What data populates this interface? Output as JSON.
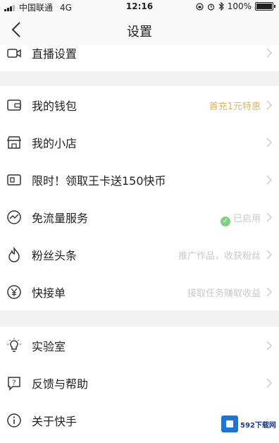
{
  "status_bar": {
    "carrier": "中国联通",
    "network": "4G",
    "time": "12:16",
    "battery": "100%"
  },
  "nav": {
    "title": "设置"
  },
  "groups": [
    {
      "items": [
        {
          "label": "直播设置",
          "value": "",
          "icon": "video-camera-icon"
        }
      ]
    },
    {
      "items": [
        {
          "label": "我的钱包",
          "value": "首充1元特惠",
          "icon": "wallet-icon"
        },
        {
          "label": "我的小店",
          "value": "",
          "icon": "store-icon"
        },
        {
          "label": "限时！领取王卡送150快币",
          "value": "",
          "icon": "sim-card-icon"
        },
        {
          "label": "免流量服务",
          "value": "已启用",
          "icon": "traffic-icon"
        },
        {
          "label": "粉丝头条",
          "value": "推广作品，收获粉丝",
          "icon": "flame-icon"
        },
        {
          "label": "快接单",
          "value": "接取任务赚取收益",
          "icon": "yuan-icon"
        }
      ]
    },
    {
      "items": [
        {
          "label": "实验室",
          "value": "",
          "icon": "lightbulb-icon"
        },
        {
          "label": "反馈与帮助",
          "value": "",
          "icon": "help-icon"
        },
        {
          "label": "关于快手",
          "value": "",
          "icon": "info-icon"
        }
      ]
    }
  ],
  "watermark": {
    "text": "592下载网"
  },
  "colors": {
    "background": "#f2f2f2",
    "row_background": "#ffffff",
    "promo": "#d9b36a",
    "muted": "#c8c8c8",
    "enabled_badge": "#7fd07f"
  }
}
